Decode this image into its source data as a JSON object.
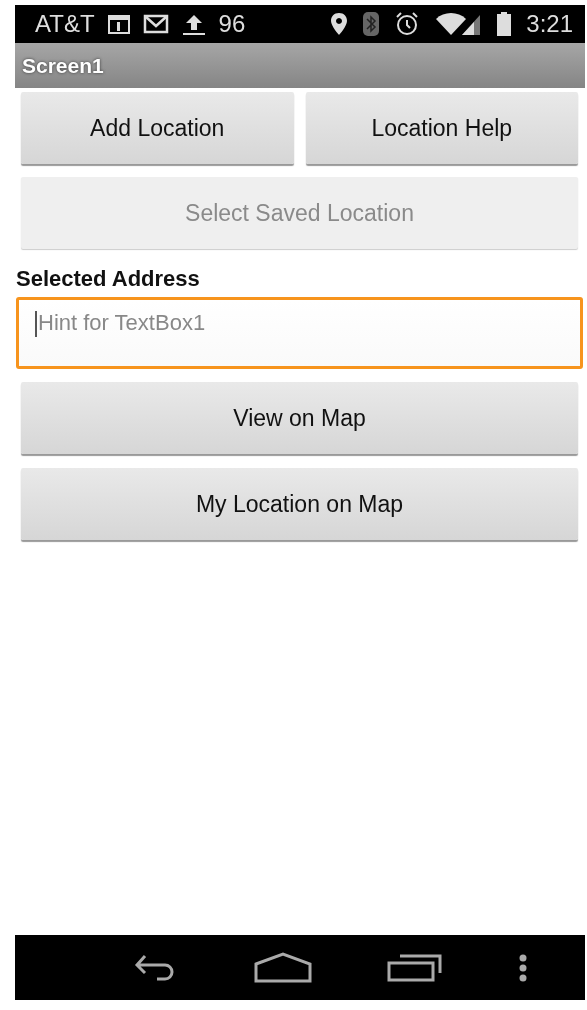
{
  "status_bar": {
    "carrier": "AT&T",
    "notification_count": "96",
    "time": "3:21"
  },
  "title_bar": {
    "title": "Screen1"
  },
  "button_row": [
    {
      "label": "Add Location",
      "disabled": false
    },
    {
      "label": "Location Help",
      "disabled": false
    }
  ],
  "buttons_top": [
    {
      "label": "Select Saved Location",
      "disabled": true
    }
  ],
  "label": "Selected Address",
  "text_box": {
    "placeholder": "Hint for TextBox1",
    "focused": true
  },
  "buttons_bottom": [
    {
      "label": "View on Map",
      "disabled": false
    },
    {
      "label": "My Location on Map",
      "disabled": false
    }
  ]
}
